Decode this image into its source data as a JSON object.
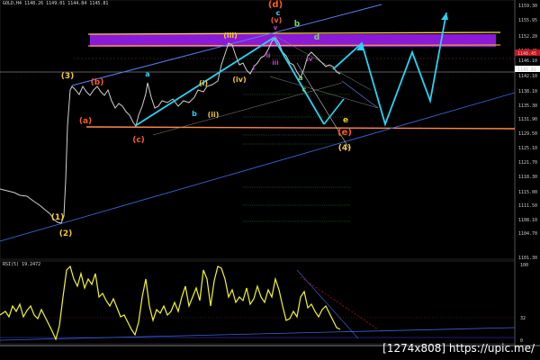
{
  "header": "GOLD,H4 1148.26 1149.01 1144.84 1145.81",
  "rsi_label": "RSI(5) 19.2472",
  "watermark": "[1274x808] https://upic.me/",
  "price_axis": {
    "labels": [
      "1159.30",
      "1155.95",
      "1152.20",
      "1148.45",
      "1146.10",
      "1142.10",
      "1138.10",
      "1135.30",
      "1131.90",
      "1129.50",
      "1125.10",
      "1121.70",
      "1118.30",
      "1115.00",
      "1111.50",
      "1108.10",
      "1104.70",
      "1101.30"
    ],
    "current_price": "1145.81",
    "highlight_price": "1148.45"
  },
  "rsi_axis": {
    "labels": [
      "100",
      "32",
      "0"
    ]
  },
  "colors": {
    "background": "#000000",
    "price": "#d0d0d0",
    "rsi": "#f5f52a",
    "wave_orange": "#ff5a1f",
    "wave_yellow": "#f2c83a",
    "wave_cyan": "#29d3f5",
    "zone_purple": "#8a1ad8",
    "channel_blue": "#3a64d8",
    "trend_white": "#cfcfcf",
    "forecast": "#29d3f5"
  },
  "wave_labels": [
    {
      "text": "(1)",
      "color": "#f2c83a"
    },
    {
      "text": "(2)",
      "color": "#f2c83a"
    },
    {
      "text": "(3)",
      "color": "#f2c83a"
    },
    {
      "text": "(b)",
      "color": "#ff5a1f"
    },
    {
      "text": "(a)",
      "color": "#ff5a1f"
    },
    {
      "text": "(c)",
      "color": "#ff5a1f"
    },
    {
      "text": "a",
      "color": "#29d3f5"
    },
    {
      "text": "b",
      "color": "#29d3f5"
    },
    {
      "text": "(ii)",
      "color": "#f2c83a"
    },
    {
      "text": "(i)",
      "color": "#f2c83a"
    },
    {
      "text": "(iii)",
      "color": "#f2c83a"
    },
    {
      "text": "(iv)",
      "color": "#f2c83a"
    },
    {
      "text": "(d)",
      "color": "#ff5a1f"
    },
    {
      "text": "c",
      "color": "#29d3f5"
    },
    {
      "text": "(v)",
      "color": "#ff5a1f"
    },
    {
      "text": "b",
      "color": "#7ad36a"
    },
    {
      "text": "d",
      "color": "#7ad36a"
    },
    {
      "text": "a",
      "color": "#7ad36a"
    },
    {
      "text": "c",
      "color": "#7ad36a"
    },
    {
      "text": "e",
      "color": "#f2c83a"
    },
    {
      "text": "(e)",
      "color": "#ff5a1f"
    },
    {
      "text": "(4)",
      "color": "#f2c83a"
    },
    {
      "text": "i",
      "color": "#c83ad8"
    },
    {
      "text": "ii",
      "color": "#c83ad8"
    },
    {
      "text": "iii",
      "color": "#c83ad8"
    },
    {
      "text": "iv",
      "color": "#c83ad8"
    },
    {
      "text": "v",
      "color": "#c83ad8"
    }
  ]
}
